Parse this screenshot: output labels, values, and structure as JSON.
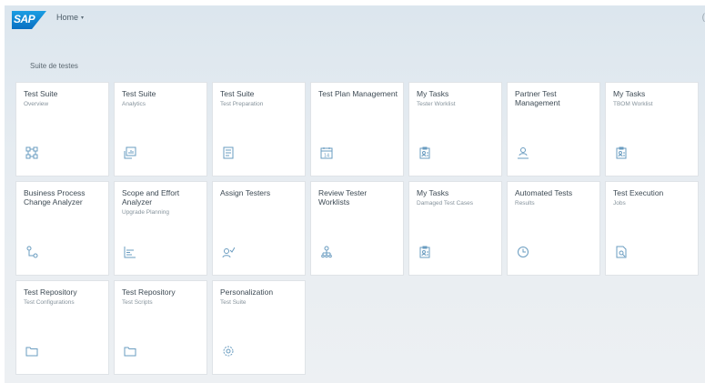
{
  "shell": {
    "logo_text": "SAP",
    "home_label": "Home",
    "home_chevron": "▾",
    "corner_text": "("
  },
  "group": {
    "title": "Suite de testes"
  },
  "tiles": [
    {
      "title": "Test Suite",
      "subtitle": "Overview",
      "icon": "overview-network-icon"
    },
    {
      "title": "Test Suite",
      "subtitle": "Analytics",
      "icon": "analytics-icon"
    },
    {
      "title": "Test Suite",
      "subtitle": "Test Preparation",
      "icon": "test-preparation-icon"
    },
    {
      "title": "Test Plan Management",
      "subtitle": "",
      "icon": "calendar-icon",
      "calendar_day": "14"
    },
    {
      "title": "My Tasks",
      "subtitle": "Tester Worklist",
      "icon": "worklist-icon"
    },
    {
      "title": "Partner Test Management",
      "subtitle": "",
      "icon": "partner-icon"
    },
    {
      "title": "My Tasks",
      "subtitle": "TBOM Worklist",
      "icon": "worklist-icon"
    },
    {
      "title": "Business Process Change Analyzer",
      "subtitle": "",
      "icon": "process-analyzer-icon"
    },
    {
      "title": "Scope and Effort Analyzer",
      "subtitle": "Upgrade Planning",
      "icon": "bar-chart-icon"
    },
    {
      "title": "Assign Testers",
      "subtitle": "",
      "icon": "assign-person-icon"
    },
    {
      "title": "Review Tester Worklists",
      "subtitle": "",
      "icon": "review-org-icon"
    },
    {
      "title": "My Tasks",
      "subtitle": "Damaged Test Cases",
      "icon": "worklist-icon"
    },
    {
      "title": "Automated Tests",
      "subtitle": "Results",
      "icon": "clock-icon"
    },
    {
      "title": "Test Execution",
      "subtitle": "Jobs",
      "icon": "job-search-icon"
    },
    {
      "title": "Test Repository",
      "subtitle": "Test Configurations",
      "icon": "folder-icon"
    },
    {
      "title": "Test Repository",
      "subtitle": "Test Scripts",
      "icon": "folder-icon"
    },
    {
      "title": "Personalization",
      "subtitle": "Test Suite",
      "icon": "settings-gear-icon"
    }
  ]
}
